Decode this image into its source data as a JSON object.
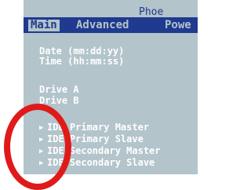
{
  "vendor": "Phoe",
  "menu": {
    "main": "Main",
    "advanced": "Advanced",
    "power": "Powe"
  },
  "fields": {
    "date": "Date (mm:dd:yy)",
    "time": "Time (hh:mm:ss)",
    "drive_a": "Drive A",
    "drive_b": "Drive B"
  },
  "submenus": [
    "IDE Primary Master",
    "IDE Primary Slave",
    "IDE Secondary Master",
    "IDE Secondary Slave"
  ],
  "colors": {
    "screen_bg": "#b3c4cb",
    "menubar_bg": "#1f3a8e",
    "text": "#ffffff",
    "highlight_ring": "#e01a1a"
  }
}
